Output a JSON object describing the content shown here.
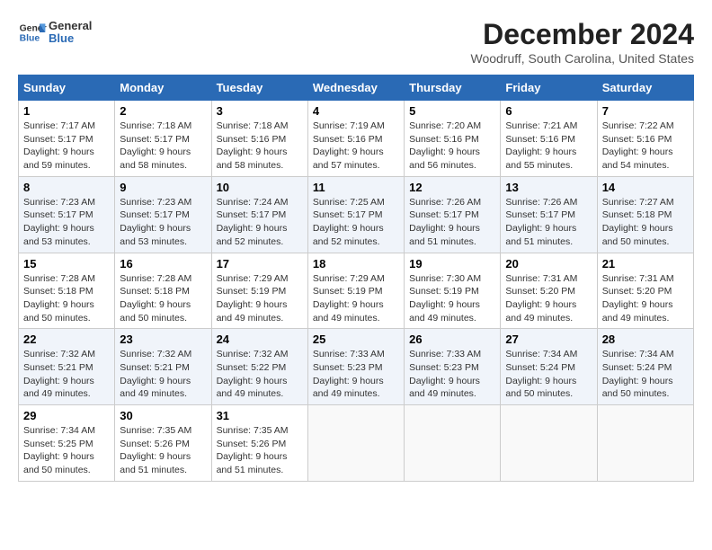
{
  "header": {
    "logo_line1": "General",
    "logo_line2": "Blue",
    "title": "December 2024",
    "subtitle": "Woodruff, South Carolina, United States"
  },
  "calendar": {
    "days_of_week": [
      "Sunday",
      "Monday",
      "Tuesday",
      "Wednesday",
      "Thursday",
      "Friday",
      "Saturday"
    ],
    "weeks": [
      [
        {
          "day": "1",
          "sunrise": "7:17 AM",
          "sunset": "5:17 PM",
          "daylight": "9 hours and 59 minutes."
        },
        {
          "day": "2",
          "sunrise": "7:18 AM",
          "sunset": "5:17 PM",
          "daylight": "9 hours and 58 minutes."
        },
        {
          "day": "3",
          "sunrise": "7:18 AM",
          "sunset": "5:16 PM",
          "daylight": "9 hours and 58 minutes."
        },
        {
          "day": "4",
          "sunrise": "7:19 AM",
          "sunset": "5:16 PM",
          "daylight": "9 hours and 57 minutes."
        },
        {
          "day": "5",
          "sunrise": "7:20 AM",
          "sunset": "5:16 PM",
          "daylight": "9 hours and 56 minutes."
        },
        {
          "day": "6",
          "sunrise": "7:21 AM",
          "sunset": "5:16 PM",
          "daylight": "9 hours and 55 minutes."
        },
        {
          "day": "7",
          "sunrise": "7:22 AM",
          "sunset": "5:16 PM",
          "daylight": "9 hours and 54 minutes."
        }
      ],
      [
        {
          "day": "8",
          "sunrise": "7:23 AM",
          "sunset": "5:17 PM",
          "daylight": "9 hours and 53 minutes."
        },
        {
          "day": "9",
          "sunrise": "7:23 AM",
          "sunset": "5:17 PM",
          "daylight": "9 hours and 53 minutes."
        },
        {
          "day": "10",
          "sunrise": "7:24 AM",
          "sunset": "5:17 PM",
          "daylight": "9 hours and 52 minutes."
        },
        {
          "day": "11",
          "sunrise": "7:25 AM",
          "sunset": "5:17 PM",
          "daylight": "9 hours and 52 minutes."
        },
        {
          "day": "12",
          "sunrise": "7:26 AM",
          "sunset": "5:17 PM",
          "daylight": "9 hours and 51 minutes."
        },
        {
          "day": "13",
          "sunrise": "7:26 AM",
          "sunset": "5:17 PM",
          "daylight": "9 hours and 51 minutes."
        },
        {
          "day": "14",
          "sunrise": "7:27 AM",
          "sunset": "5:18 PM",
          "daylight": "9 hours and 50 minutes."
        }
      ],
      [
        {
          "day": "15",
          "sunrise": "7:28 AM",
          "sunset": "5:18 PM",
          "daylight": "9 hours and 50 minutes."
        },
        {
          "day": "16",
          "sunrise": "7:28 AM",
          "sunset": "5:18 PM",
          "daylight": "9 hours and 50 minutes."
        },
        {
          "day": "17",
          "sunrise": "7:29 AM",
          "sunset": "5:19 PM",
          "daylight": "9 hours and 49 minutes."
        },
        {
          "day": "18",
          "sunrise": "7:29 AM",
          "sunset": "5:19 PM",
          "daylight": "9 hours and 49 minutes."
        },
        {
          "day": "19",
          "sunrise": "7:30 AM",
          "sunset": "5:19 PM",
          "daylight": "9 hours and 49 minutes."
        },
        {
          "day": "20",
          "sunrise": "7:31 AM",
          "sunset": "5:20 PM",
          "daylight": "9 hours and 49 minutes."
        },
        {
          "day": "21",
          "sunrise": "7:31 AM",
          "sunset": "5:20 PM",
          "daylight": "9 hours and 49 minutes."
        }
      ],
      [
        {
          "day": "22",
          "sunrise": "7:32 AM",
          "sunset": "5:21 PM",
          "daylight": "9 hours and 49 minutes."
        },
        {
          "day": "23",
          "sunrise": "7:32 AM",
          "sunset": "5:21 PM",
          "daylight": "9 hours and 49 minutes."
        },
        {
          "day": "24",
          "sunrise": "7:32 AM",
          "sunset": "5:22 PM",
          "daylight": "9 hours and 49 minutes."
        },
        {
          "day": "25",
          "sunrise": "7:33 AM",
          "sunset": "5:23 PM",
          "daylight": "9 hours and 49 minutes."
        },
        {
          "day": "26",
          "sunrise": "7:33 AM",
          "sunset": "5:23 PM",
          "daylight": "9 hours and 49 minutes."
        },
        {
          "day": "27",
          "sunrise": "7:34 AM",
          "sunset": "5:24 PM",
          "daylight": "9 hours and 50 minutes."
        },
        {
          "day": "28",
          "sunrise": "7:34 AM",
          "sunset": "5:24 PM",
          "daylight": "9 hours and 50 minutes."
        }
      ],
      [
        {
          "day": "29",
          "sunrise": "7:34 AM",
          "sunset": "5:25 PM",
          "daylight": "9 hours and 50 minutes."
        },
        {
          "day": "30",
          "sunrise": "7:35 AM",
          "sunset": "5:26 PM",
          "daylight": "9 hours and 51 minutes."
        },
        {
          "day": "31",
          "sunrise": "7:35 AM",
          "sunset": "5:26 PM",
          "daylight": "9 hours and 51 minutes."
        },
        null,
        null,
        null,
        null
      ]
    ]
  }
}
